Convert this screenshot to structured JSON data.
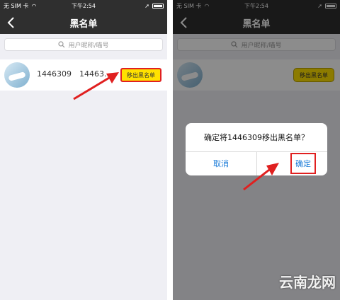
{
  "status_bar": {
    "carrier": "无 SIM 卡",
    "time": "下午2:54"
  },
  "nav": {
    "title": "黑名单"
  },
  "search": {
    "placeholder": "用户昵称/喵号"
  },
  "blacklist_row": {
    "user_id": "1446309",
    "nickname": "14463...",
    "remove_label": "移出黑名单"
  },
  "confirm_dialog": {
    "message": "确定将1446309移出黑名单？",
    "cancel_label": "取消",
    "confirm_label": "确定"
  },
  "watermark": {
    "text": "云南龙网"
  },
  "colors": {
    "nav_bg": "#2f2f2f",
    "highlight_border": "#e02020",
    "button_yellow": "#ffe100",
    "link_blue": "#1a7bd8"
  },
  "icons": {
    "back": "back-chevron-icon",
    "search": "search-icon",
    "wifi": "wifi-icon",
    "location": "location-arrow-icon",
    "battery": "battery-icon",
    "arrow": "red-pointer-arrow-icon"
  }
}
